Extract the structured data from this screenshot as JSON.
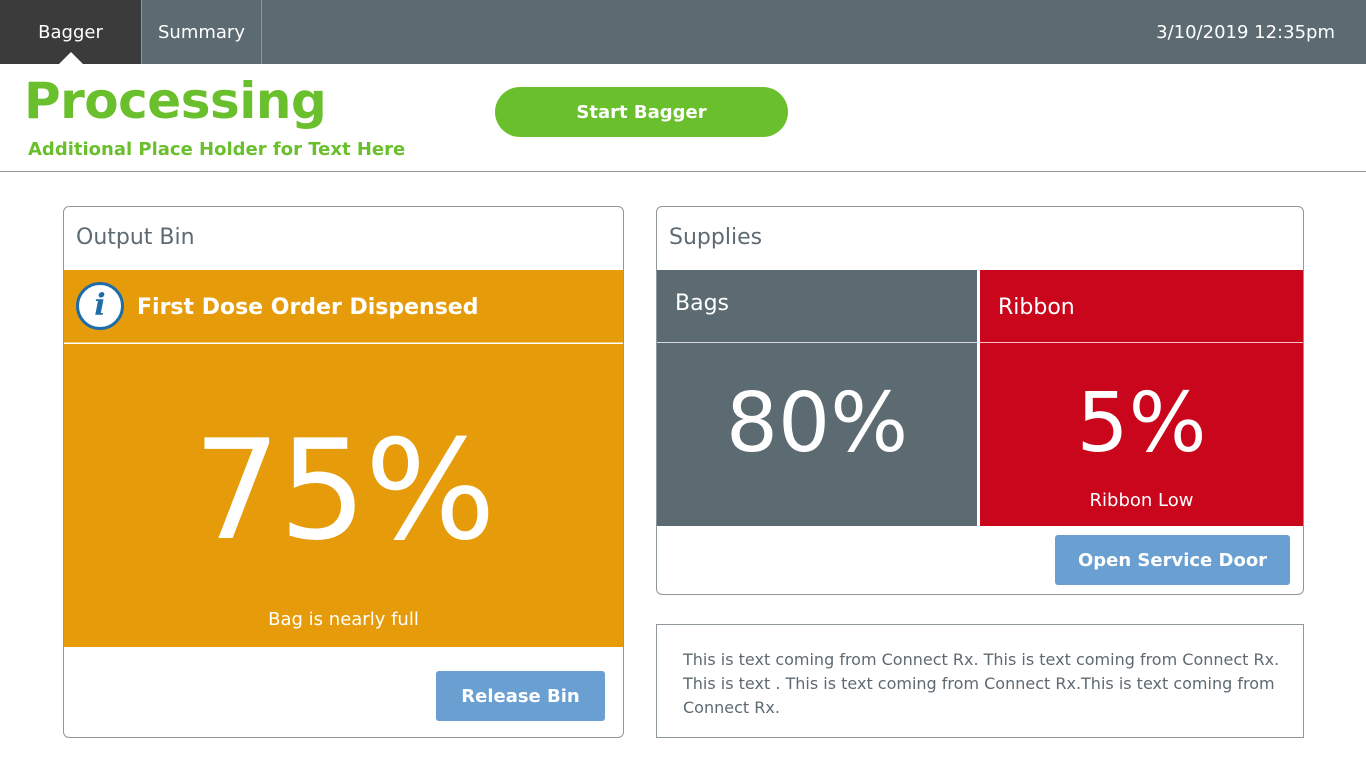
{
  "nav": {
    "tabs": [
      {
        "label": "Bagger",
        "active": true
      },
      {
        "label": "Summary",
        "active": false
      }
    ],
    "datetime": "3/10/2019 12:35pm"
  },
  "header": {
    "status": "Processing",
    "subtitle": "Additional Place Holder for Text Here",
    "start_button": "Start Bagger"
  },
  "output_bin": {
    "title": "Output Bin",
    "alert_icon": "info-icon",
    "alert_text": "First Dose Order Dispensed",
    "fill_percent": "75%",
    "caption": "Bag is nearly full",
    "release_button": "Release Bin"
  },
  "supplies": {
    "title": "Supplies",
    "bags": {
      "label": "Bags",
      "value": "80%",
      "note": ""
    },
    "ribbon": {
      "label": "Ribbon",
      "value": "5%",
      "note": "Ribbon Low"
    },
    "service_button": "Open Service Door"
  },
  "message": {
    "text": "This is text coming from Connect Rx.  This is text coming from Connect Rx.  This is text .  This is text coming from Connect Rx.This is text coming from Connect Rx."
  },
  "colors": {
    "nav_bg": "#5c6a72",
    "active_tab": "#3b3b3b",
    "accent_green": "#6abf2c",
    "warning_orange": "#e69c0a",
    "alert_red": "#c9061c",
    "action_blue": "#6a9fd1",
    "info_blue": "#1f6da8"
  }
}
